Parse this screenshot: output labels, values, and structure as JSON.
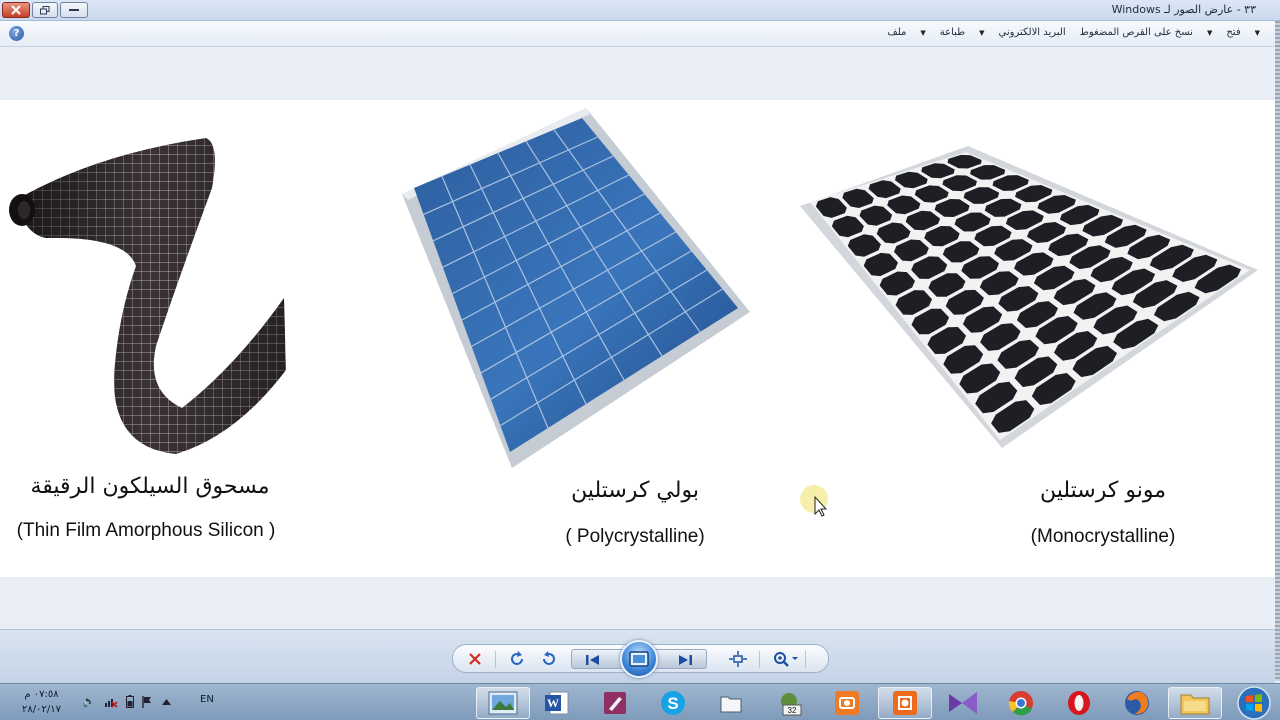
{
  "window": {
    "title": "٣٣ - عارض الصور لـ Windows"
  },
  "menubar": {
    "items": [
      {
        "label": "ملف"
      },
      {
        "label": "طباعة"
      },
      {
        "label": "البريد الالكتروني"
      },
      {
        "label": "نسخ على القرص المضغوط"
      },
      {
        "label": "فتح"
      }
    ],
    "help_icon": "help-icon"
  },
  "slide": {
    "panels": [
      {
        "title_ar": "مسحوق السيلكون الرقيقة",
        "title_en": "(Thin Film Amorphous Silicon )",
        "image": "thin-film-panel-image"
      },
      {
        "title_ar": "بولي كرستلين",
        "title_en": "( Polycrystalline)",
        "image": "polycrystalline-panel-image"
      },
      {
        "title_ar": "مونو كرستلين",
        "title_en": "(Monocrystalline)",
        "image": "monocrystalline-panel-image"
      }
    ]
  },
  "controls": {
    "delete_icon": "delete-icon",
    "rotate_cw_icon": "rotate-clockwise-icon",
    "rotate_ccw_icon": "rotate-counterclockwise-icon",
    "prev_icon": "previous-icon",
    "slideshow_icon": "slideshow-icon",
    "next_icon": "next-icon",
    "actual_size_icon": "actual-size-icon",
    "zoom_icon": "zoom-icon"
  },
  "taskbar": {
    "time": "٠٧:٥٨ م",
    "date": "٢٨/٠٢/١٧",
    "language": "EN",
    "apps": [
      "photo-viewer",
      "word",
      "paint-brush",
      "skype",
      "folder",
      "game-32",
      "camera",
      "camera-2",
      "visual-studio",
      "chrome",
      "opera",
      "firefox",
      "explorer"
    ]
  },
  "colors": {
    "accent": "#3a83d6",
    "taskbar": "#8ea8c6"
  }
}
